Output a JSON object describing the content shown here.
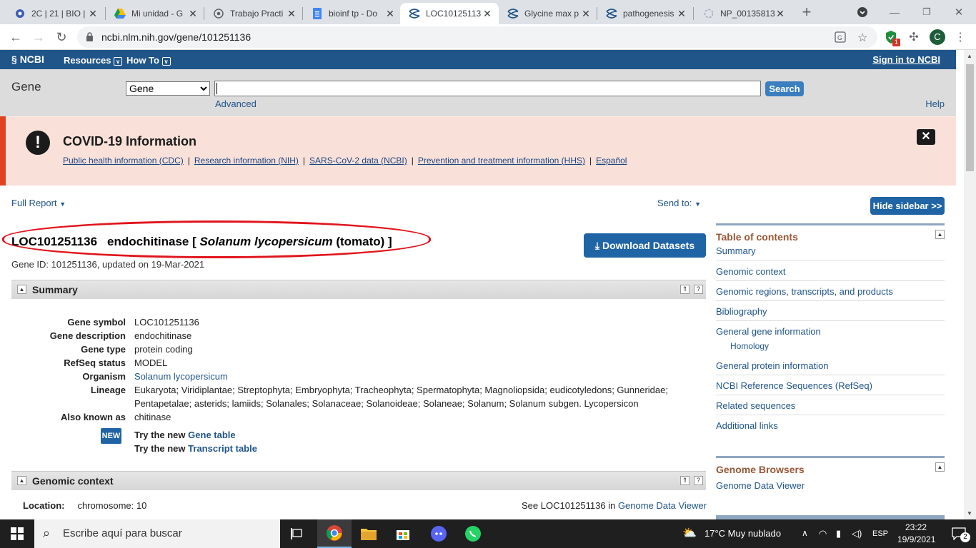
{
  "browser": {
    "tabs": [
      {
        "label": "2C | 21 | BIO |",
        "icon": "globe-icon"
      },
      {
        "label": "Mi unidad - G",
        "icon": "drive-icon"
      },
      {
        "label": "Trabajo Practi",
        "icon": "chrome-icon"
      },
      {
        "label": "bioinf tp - Do",
        "icon": "docs-icon"
      },
      {
        "label": "LOC10125113",
        "icon": "ncbi-dna-icon",
        "active": true
      },
      {
        "label": "Glycine max p",
        "icon": "ncbi-dna-icon"
      },
      {
        "label": "pathogenesis",
        "icon": "ncbi-dna-icon"
      },
      {
        "label": "NP_00135813",
        "icon": "loading-icon"
      }
    ],
    "url": "ncbi.nlm.nih.gov/gene/101251136",
    "profile_initial": "C",
    "extension_badge": "1"
  },
  "ncbi": {
    "logo": "NCBI",
    "menu": [
      "Resources",
      "How To"
    ],
    "signin": "Sign in to NCBI",
    "db_title": "Gene",
    "db_selected": "Gene",
    "search_button": "Search",
    "advanced": "Advanced",
    "help": "Help"
  },
  "covid": {
    "title": "COVID-19 Information",
    "links": [
      "Public health information (CDC)",
      "Research information (NIH)",
      "SARS-CoV-2 data (NCBI)",
      "Prevention and treatment information (HHS)",
      "Español"
    ],
    "separator": "|"
  },
  "report": {
    "full_report": "Full Report",
    "send_to": "Send to:",
    "hide_sidebar": "Hide sidebar >>",
    "gene_symbol_title": "LOC101251136",
    "gene_desc_title": "endochitinase [",
    "organism_italic": "Solanum lycopersicum",
    "organism_common": "(tomato) ]",
    "download": "Download Datasets",
    "gene_id_line": "Gene ID: 101251136, updated on 19-Mar-2021"
  },
  "summary": {
    "section_title": "Summary",
    "rows": [
      {
        "label": "Gene symbol",
        "value": "LOC101251136"
      },
      {
        "label": "Gene description",
        "value": "endochitinase"
      },
      {
        "label": "Gene type",
        "value": "protein coding"
      },
      {
        "label": "RefSeq status",
        "value": "MODEL"
      },
      {
        "label": "Organism",
        "value": "Solanum lycopersicum"
      },
      {
        "label": "Lineage",
        "value": "Eukaryota; Viridiplantae; Streptophyta; Embryophyta; Tracheophyta; Spermatophyta; Magnoliopsida; eudicotyledons; Gunneridae; Pentapetalae; asterids; lamiids; Solanales; Solanaceae; Solanoideae; Solaneae; Solanum; Solanum subgen. Lycopersicon"
      },
      {
        "label": "Also known as",
        "value": "chitinase"
      }
    ],
    "new_badge": "NEW",
    "try_prefix": "Try the new",
    "try_gene_link": "Gene table",
    "try_transcript_link": "Transcript table"
  },
  "genomic": {
    "section_title": "Genomic context",
    "location_label": "Location:",
    "location_value": "chromosome: 10",
    "see_text": "See LOC101251136 in",
    "see_link": "Genome Data Viewer"
  },
  "sidebar": {
    "toc_title": "Table of contents",
    "toc": [
      "Summary",
      "Genomic context",
      "Genomic regions, transcripts, and products",
      "Bibliography",
      "General gene information",
      "Homology",
      "General protein information",
      "NCBI Reference Sequences (RefSeq)",
      "Related sequences",
      "Additional links"
    ],
    "browsers_title": "Genome Browsers",
    "browsers": [
      "Genome Data Viewer"
    ]
  },
  "taskbar": {
    "search_placeholder": "Escribe aquí para buscar",
    "weather": "17°C  Muy nublado",
    "lang": "ESP",
    "time": "23:22",
    "date": "19/9/2021",
    "notifications": "2"
  }
}
